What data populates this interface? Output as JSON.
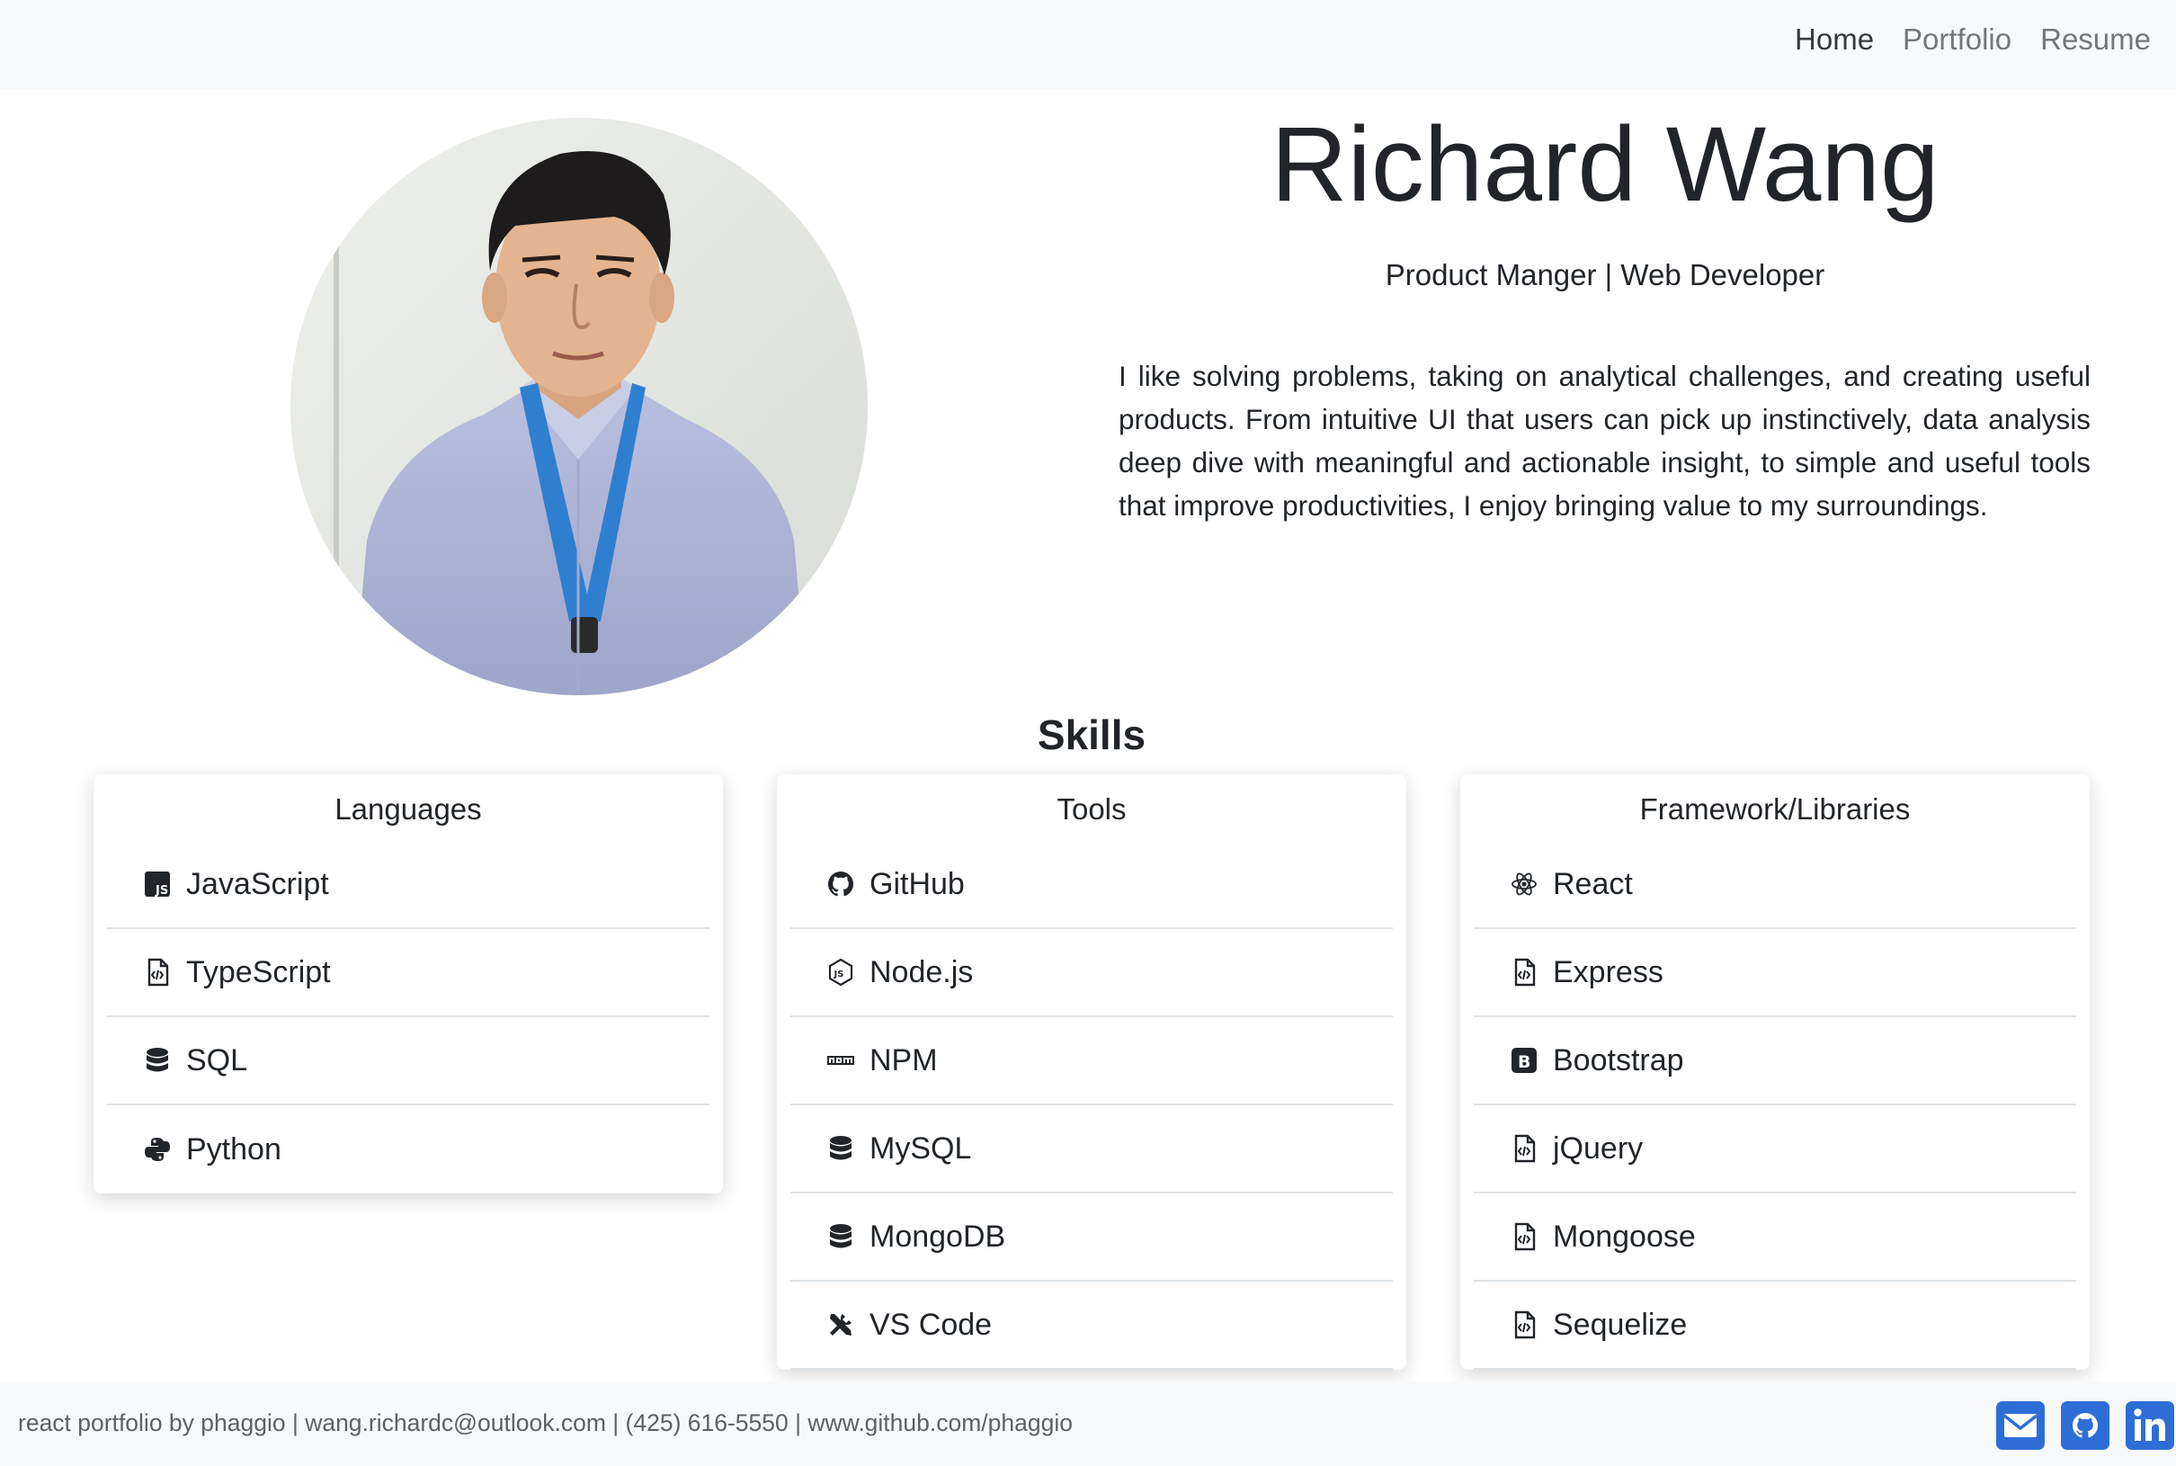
{
  "nav": {
    "links": [
      {
        "label": "Home",
        "active": true
      },
      {
        "label": "Portfolio",
        "active": false
      },
      {
        "label": "Resume",
        "active": false
      }
    ]
  },
  "hero": {
    "name": "Richard Wang",
    "subtitle": "Product Manger | Web Developer",
    "bio": "I like solving problems, taking on analytical challenges, and creating useful products. From intuitive UI that users can pick up instinctively, data analysis deep dive with meaningful and actionable insight, to simple and useful tools that improve productivities, I enjoy bringing value to my surroundings."
  },
  "skills": {
    "title": "Skills",
    "cards": [
      {
        "title": "Languages",
        "items": [
          {
            "label": "JavaScript",
            "icon": "javascript-icon"
          },
          {
            "label": "TypeScript",
            "icon": "code-file-icon"
          },
          {
            "label": "SQL",
            "icon": "database-icon"
          },
          {
            "label": "Python",
            "icon": "python-icon"
          }
        ]
      },
      {
        "title": "Tools",
        "items": [
          {
            "label": "GitHub",
            "icon": "github-icon"
          },
          {
            "label": "Node.js",
            "icon": "nodejs-icon"
          },
          {
            "label": "NPM",
            "icon": "npm-icon"
          },
          {
            "label": "MySQL",
            "icon": "database-icon"
          },
          {
            "label": "MongoDB",
            "icon": "database-icon"
          },
          {
            "label": "VS Code",
            "icon": "tools-icon"
          }
        ]
      },
      {
        "title": "Framework/Libraries",
        "items": [
          {
            "label": "React",
            "icon": "react-icon"
          },
          {
            "label": "Express",
            "icon": "code-file-icon"
          },
          {
            "label": "Bootstrap",
            "icon": "bootstrap-icon"
          },
          {
            "label": "jQuery",
            "icon": "code-file-icon"
          },
          {
            "label": "Mongoose",
            "icon": "code-file-icon"
          },
          {
            "label": "Sequelize",
            "icon": "code-file-icon"
          }
        ]
      }
    ]
  },
  "footer": {
    "text": "react portfolio by phaggio | wang.richardc@outlook.com | (425) 616-5550 | www.github.com/phaggio",
    "icons": [
      "email-icon",
      "github-icon",
      "linkedin-icon"
    ]
  },
  "colors": {
    "footer_icon_blue": "#2d6ed6",
    "navbar_bg": "#f8f9fa",
    "text_dark": "#212529"
  }
}
